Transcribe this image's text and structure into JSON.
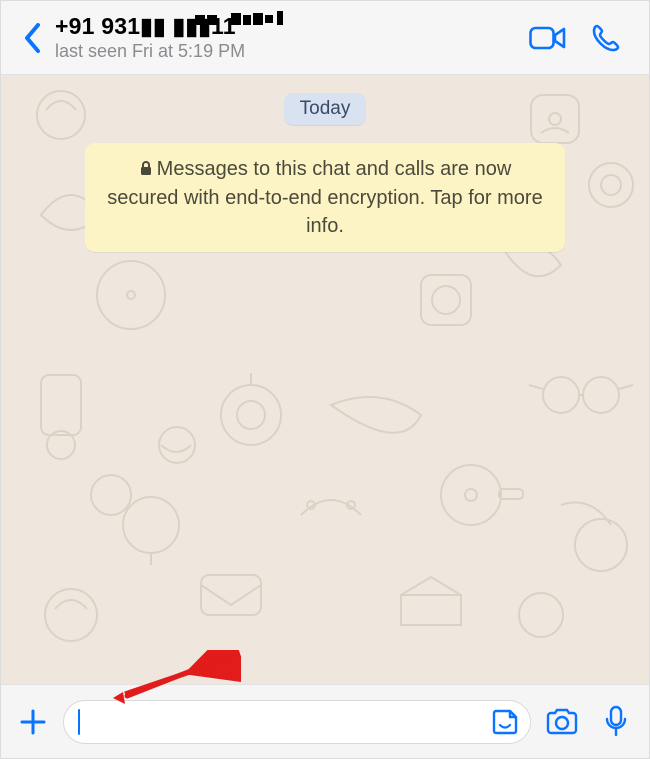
{
  "header": {
    "contact_name": "+91 931▮▮ ▮▮▮11",
    "last_seen": "last seen Fri at 5:19 PM"
  },
  "chat": {
    "date_label": "Today",
    "encryption_notice": "Messages to this chat and calls are now secured with end-to-end encryption. Tap for more info."
  },
  "footer": {
    "input_value": "",
    "input_placeholder": ""
  },
  "colors": {
    "accent": "#0b74ff"
  }
}
